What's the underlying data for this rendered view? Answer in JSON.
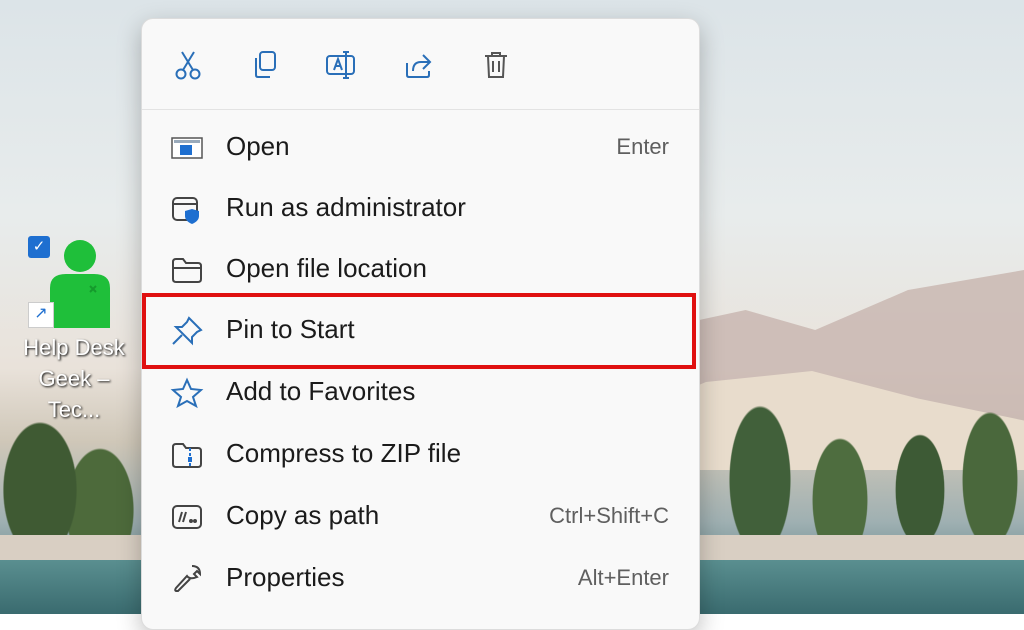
{
  "desktop": {
    "shortcut": {
      "label_line1": "Help Desk",
      "label_line2": "Geek – Tec...",
      "selected": true
    }
  },
  "context_menu": {
    "toolbar": [
      {
        "name": "cut",
        "icon": "scissors-icon"
      },
      {
        "name": "copy",
        "icon": "copy-icon"
      },
      {
        "name": "rename",
        "icon": "rename-icon"
      },
      {
        "name": "share",
        "icon": "share-icon"
      },
      {
        "name": "delete",
        "icon": "trash-icon"
      }
    ],
    "items": [
      {
        "label": "Open",
        "shortcut": "Enter",
        "icon": "app-window-icon"
      },
      {
        "label": "Run as administrator",
        "shortcut": "",
        "icon": "shield-window-icon"
      },
      {
        "label": "Open file location",
        "shortcut": "",
        "icon": "folder-icon"
      },
      {
        "label": "Pin to Start",
        "shortcut": "",
        "icon": "pin-icon",
        "highlighted": true
      },
      {
        "label": "Add to Favorites",
        "shortcut": "",
        "icon": "star-icon"
      },
      {
        "label": "Compress to ZIP file",
        "shortcut": "",
        "icon": "zip-folder-icon"
      },
      {
        "label": "Copy as path",
        "shortcut": "Ctrl+Shift+C",
        "icon": "copy-path-icon"
      },
      {
        "label": "Properties",
        "shortcut": "Alt+Enter",
        "icon": "wrench-icon"
      }
    ]
  },
  "colors": {
    "accent": "#1e6fd0",
    "highlight_border": "#e01010",
    "menu_bg": "#f9f9f9"
  }
}
